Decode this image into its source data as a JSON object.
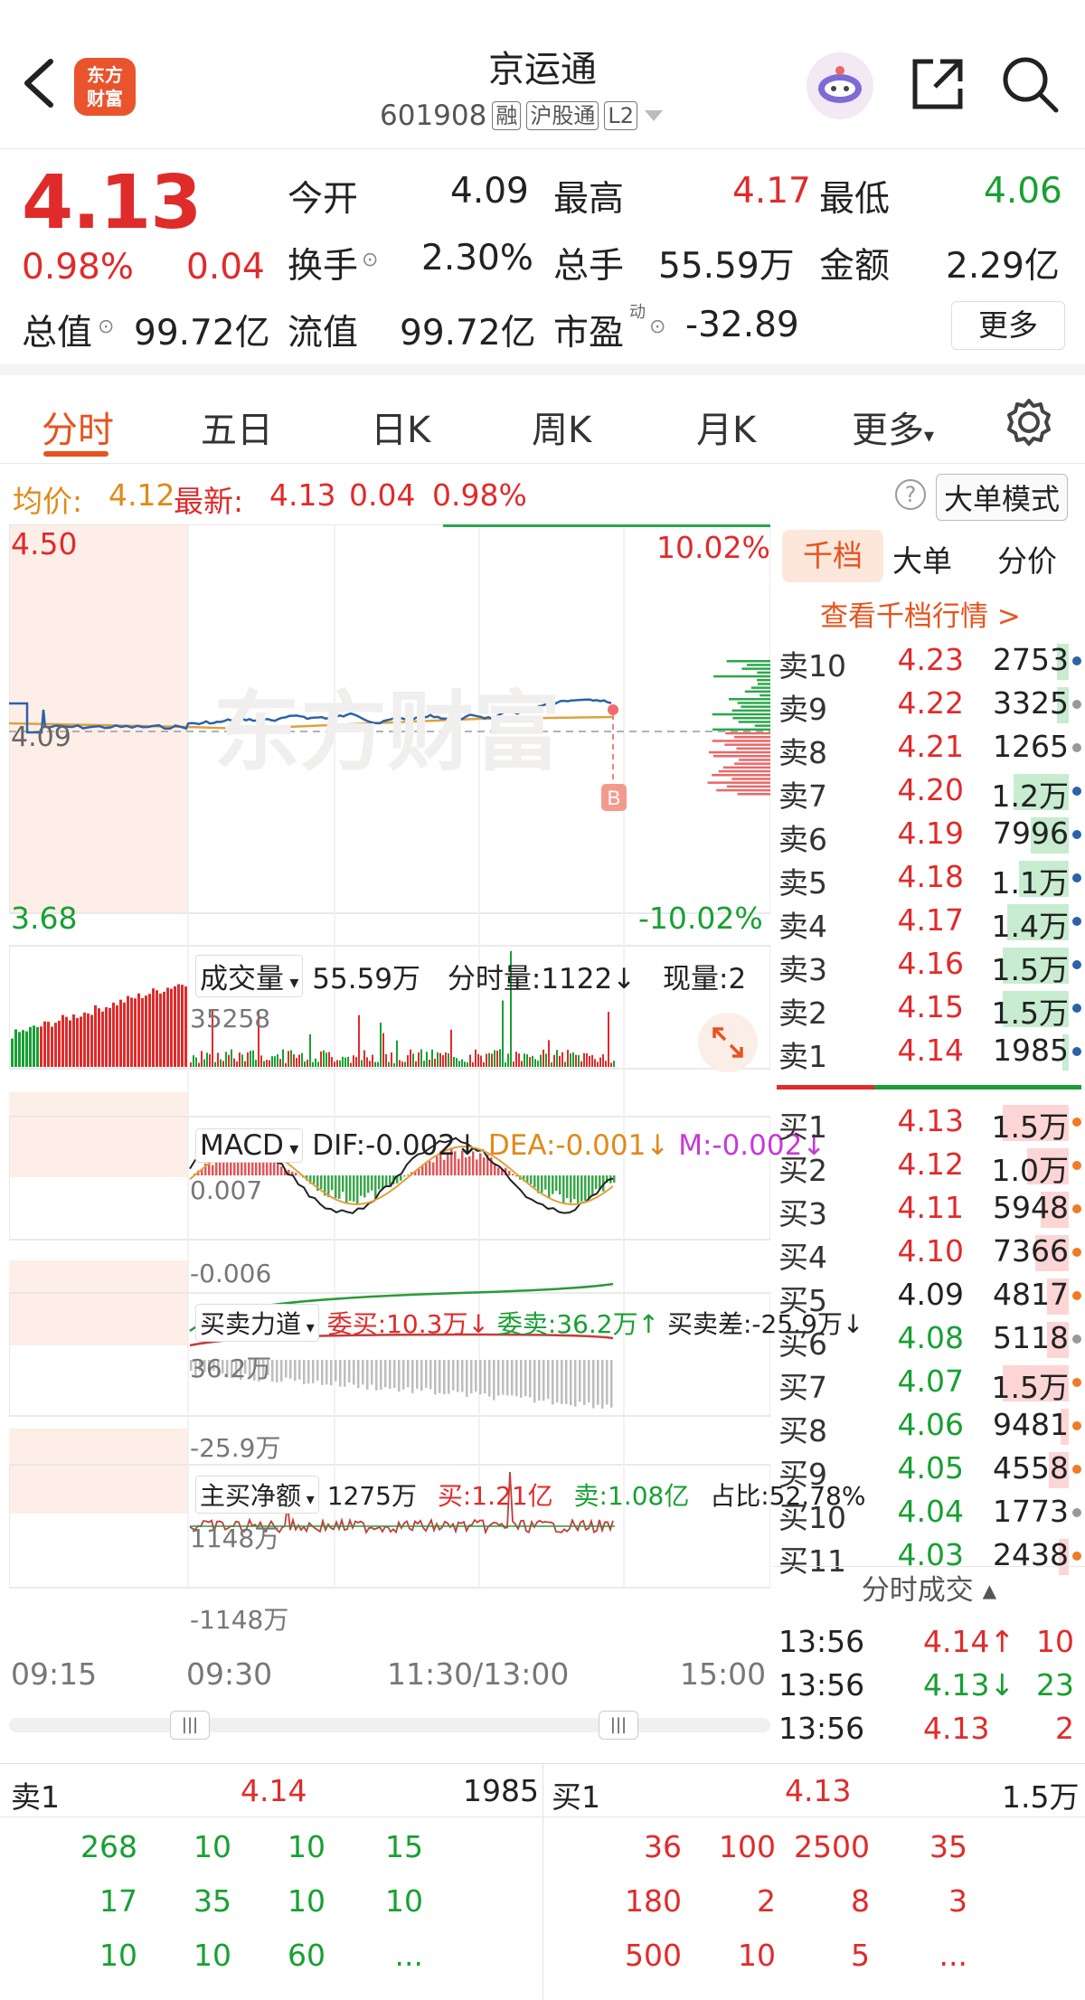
{
  "header": {
    "title": "京运通",
    "code": "601908",
    "tags": [
      "融",
      "沪股通",
      "L2"
    ],
    "logo_text_line1": "东方",
    "logo_text_line2": "财富"
  },
  "quote": {
    "price": "4.13",
    "change_pct": "0.98%",
    "change": "0.04",
    "rows": [
      [
        {
          "label": "今开",
          "value": "4.09",
          "color": "dark"
        },
        {
          "label": "最高",
          "value": "4.17",
          "color": "red"
        },
        {
          "label": "最低",
          "value": "4.06",
          "color": "green"
        }
      ],
      [
        {
          "label": "换手",
          "value": "2.30%",
          "color": "dark"
        },
        {
          "label": "总手",
          "value": "55.59万",
          "color": "dark"
        },
        {
          "label": "金额",
          "value": "2.29亿",
          "color": "dark"
        }
      ],
      [
        {
          "label": "总值",
          "value": "99.72亿",
          "color": "dark"
        },
        {
          "label": "流值",
          "value": "99.72亿",
          "color": "dark"
        },
        {
          "label": "市盈",
          "value": "-32.89",
          "color": "dark"
        }
      ]
    ],
    "pe_superscript": "动",
    "more_label": "更多"
  },
  "tabs": [
    "分时",
    "五日",
    "日K",
    "周K",
    "月K",
    "更多"
  ],
  "info": {
    "avg_label": "均价:",
    "avg_value": "4.12",
    "latest_label": "最新:",
    "latest_value": "4.13",
    "change": "0.04",
    "change_pct": "0.98%",
    "big_mode": "大单模式"
  },
  "main_chart": {
    "high_label": "4.50",
    "low_label": "3.68",
    "mid_label": "4.09",
    "up_pct": "10.02%",
    "down_pct": "-10.02%",
    "marker": "B",
    "watermark": "东方财富"
  },
  "volume_panel": {
    "name": "成交量",
    "total": "55.59万",
    "fs_label": "分时量:1122↓",
    "now_label": "现量:2",
    "max_label": "35258"
  },
  "macd_panel": {
    "name": "MACD",
    "dif": "DIF:-0.002↓",
    "dea": "DEA:-0.001↓",
    "m": "M:-0.002↓",
    "top_label": "0.007",
    "bottom_label": "-0.006"
  },
  "force_panel": {
    "name": "买卖力道",
    "wei_buy": "委买:10.3万↓",
    "wei_sell": "委卖:36.2万↑",
    "diff": "买卖差:-25.9万↓",
    "top_label": "36.2万",
    "bottom_label": "-25.9万"
  },
  "net_panel": {
    "name": "主买净额",
    "value": "1275万",
    "buy": "买:1.21亿",
    "sell": "卖:1.08亿",
    "ratio": "占比:52.78%",
    "top_label": "1148万",
    "bottom_label": "-1148万"
  },
  "time_axis": [
    "09:15",
    "09:30",
    "11:30/13:00",
    "15:00"
  ],
  "book_tabs": [
    "千档",
    "大单",
    "分价"
  ],
  "book_link": "查看千档行情 >",
  "asks": [
    {
      "name": "卖10",
      "price": "4.23",
      "vol": "2753",
      "pcolor": "red",
      "bar": 0.12,
      "dot": "blue"
    },
    {
      "name": "卖9",
      "price": "4.22",
      "vol": "3325",
      "pcolor": "red",
      "bar": 0.12,
      "dot": "gray"
    },
    {
      "name": "卖8",
      "price": "4.21",
      "vol": "1265",
      "pcolor": "red",
      "bar": 0,
      "dot": "gray"
    },
    {
      "name": "卖7",
      "price": "4.20",
      "vol": "1.2万",
      "pcolor": "red",
      "bar": 0.55,
      "dot": "blue"
    },
    {
      "name": "卖6",
      "price": "4.19",
      "vol": "7996",
      "pcolor": "red",
      "bar": 0.38,
      "dot": "blue"
    },
    {
      "name": "卖5",
      "price": "4.18",
      "vol": "1.1万",
      "pcolor": "red",
      "bar": 0.5,
      "dot": "blue"
    },
    {
      "name": "卖4",
      "price": "4.17",
      "vol": "1.4万",
      "pcolor": "red",
      "bar": 0.62,
      "dot": "blue"
    },
    {
      "name": "卖3",
      "price": "4.16",
      "vol": "1.5万",
      "pcolor": "red",
      "bar": 0.66,
      "dot": "blue"
    },
    {
      "name": "卖2",
      "price": "4.15",
      "vol": "1.5万",
      "pcolor": "red",
      "bar": 0.66,
      "dot": "blue"
    },
    {
      "name": "卖1",
      "price": "4.14",
      "vol": "1985",
      "pcolor": "red",
      "bar": 0.06,
      "dot": "blue"
    }
  ],
  "bids": [
    {
      "name": "买1",
      "price": "4.13",
      "vol": "1.5万",
      "pcolor": "red",
      "bar": 0.66,
      "dot": "orange"
    },
    {
      "name": "买2",
      "price": "4.12",
      "vol": "1.0万",
      "pcolor": "red",
      "bar": 0.42,
      "dot": "orange"
    },
    {
      "name": "买3",
      "price": "4.11",
      "vol": "5948",
      "pcolor": "red",
      "bar": 0.28,
      "dot": "orange"
    },
    {
      "name": "买4",
      "price": "4.10",
      "vol": "7366",
      "pcolor": "red",
      "bar": 0.34,
      "dot": "orange"
    },
    {
      "name": "买5",
      "price": "4.09",
      "vol": "4817",
      "pcolor": "dark",
      "bar": 0.22,
      "dot": "orange"
    },
    {
      "name": "买6",
      "price": "4.08",
      "vol": "5118",
      "pcolor": "green",
      "bar": 0.22,
      "dot": "gray"
    },
    {
      "name": "买7",
      "price": "4.07",
      "vol": "1.5万",
      "pcolor": "green",
      "bar": 0.66,
      "dot": "orange"
    },
    {
      "name": "买8",
      "price": "4.06",
      "vol": "9481",
      "pcolor": "green",
      "bar": 0.08,
      "dot": "orange"
    },
    {
      "name": "买9",
      "price": "4.05",
      "vol": "4558",
      "pcolor": "green",
      "bar": 0.2,
      "dot": "orange"
    },
    {
      "name": "买10",
      "price": "4.04",
      "vol": "1773",
      "pcolor": "green",
      "bar": 0,
      "dot": "gray"
    },
    {
      "name": "买11",
      "price": "4.03",
      "vol": "2438",
      "pcolor": "green",
      "bar": 0.1,
      "dot": "orange"
    }
  ],
  "ticks_title": "分时成交",
  "ticks": [
    {
      "time": "13:56",
      "price": "4.14↑",
      "vol": "10"
    },
    {
      "time": "13:56",
      "price": "4.13↓",
      "vol": "23"
    },
    {
      "time": "13:56",
      "price": "4.13",
      "vol": "2"
    }
  ],
  "bottom": {
    "sell_label": "卖1",
    "sell_price": "4.14",
    "sell_vol": "1985",
    "buy_label": "买1",
    "buy_price": "4.13",
    "buy_vol": "1.5万",
    "sell_queue": [
      [
        "268",
        "10",
        "10",
        "15"
      ],
      [
        "17",
        "35",
        "10",
        "10"
      ],
      [
        "10",
        "10",
        "60",
        "..."
      ]
    ],
    "buy_queue": [
      [
        "36",
        "100",
        "2500",
        "35"
      ],
      [
        "180",
        "2",
        "8",
        "3"
      ],
      [
        "500",
        "10",
        "5",
        "..."
      ]
    ]
  },
  "colors": {
    "red": "#e02b2b",
    "green": "#18a033",
    "accent": "#e6531d",
    "blue": "#2d62a8",
    "avg": "#e0a23a"
  }
}
